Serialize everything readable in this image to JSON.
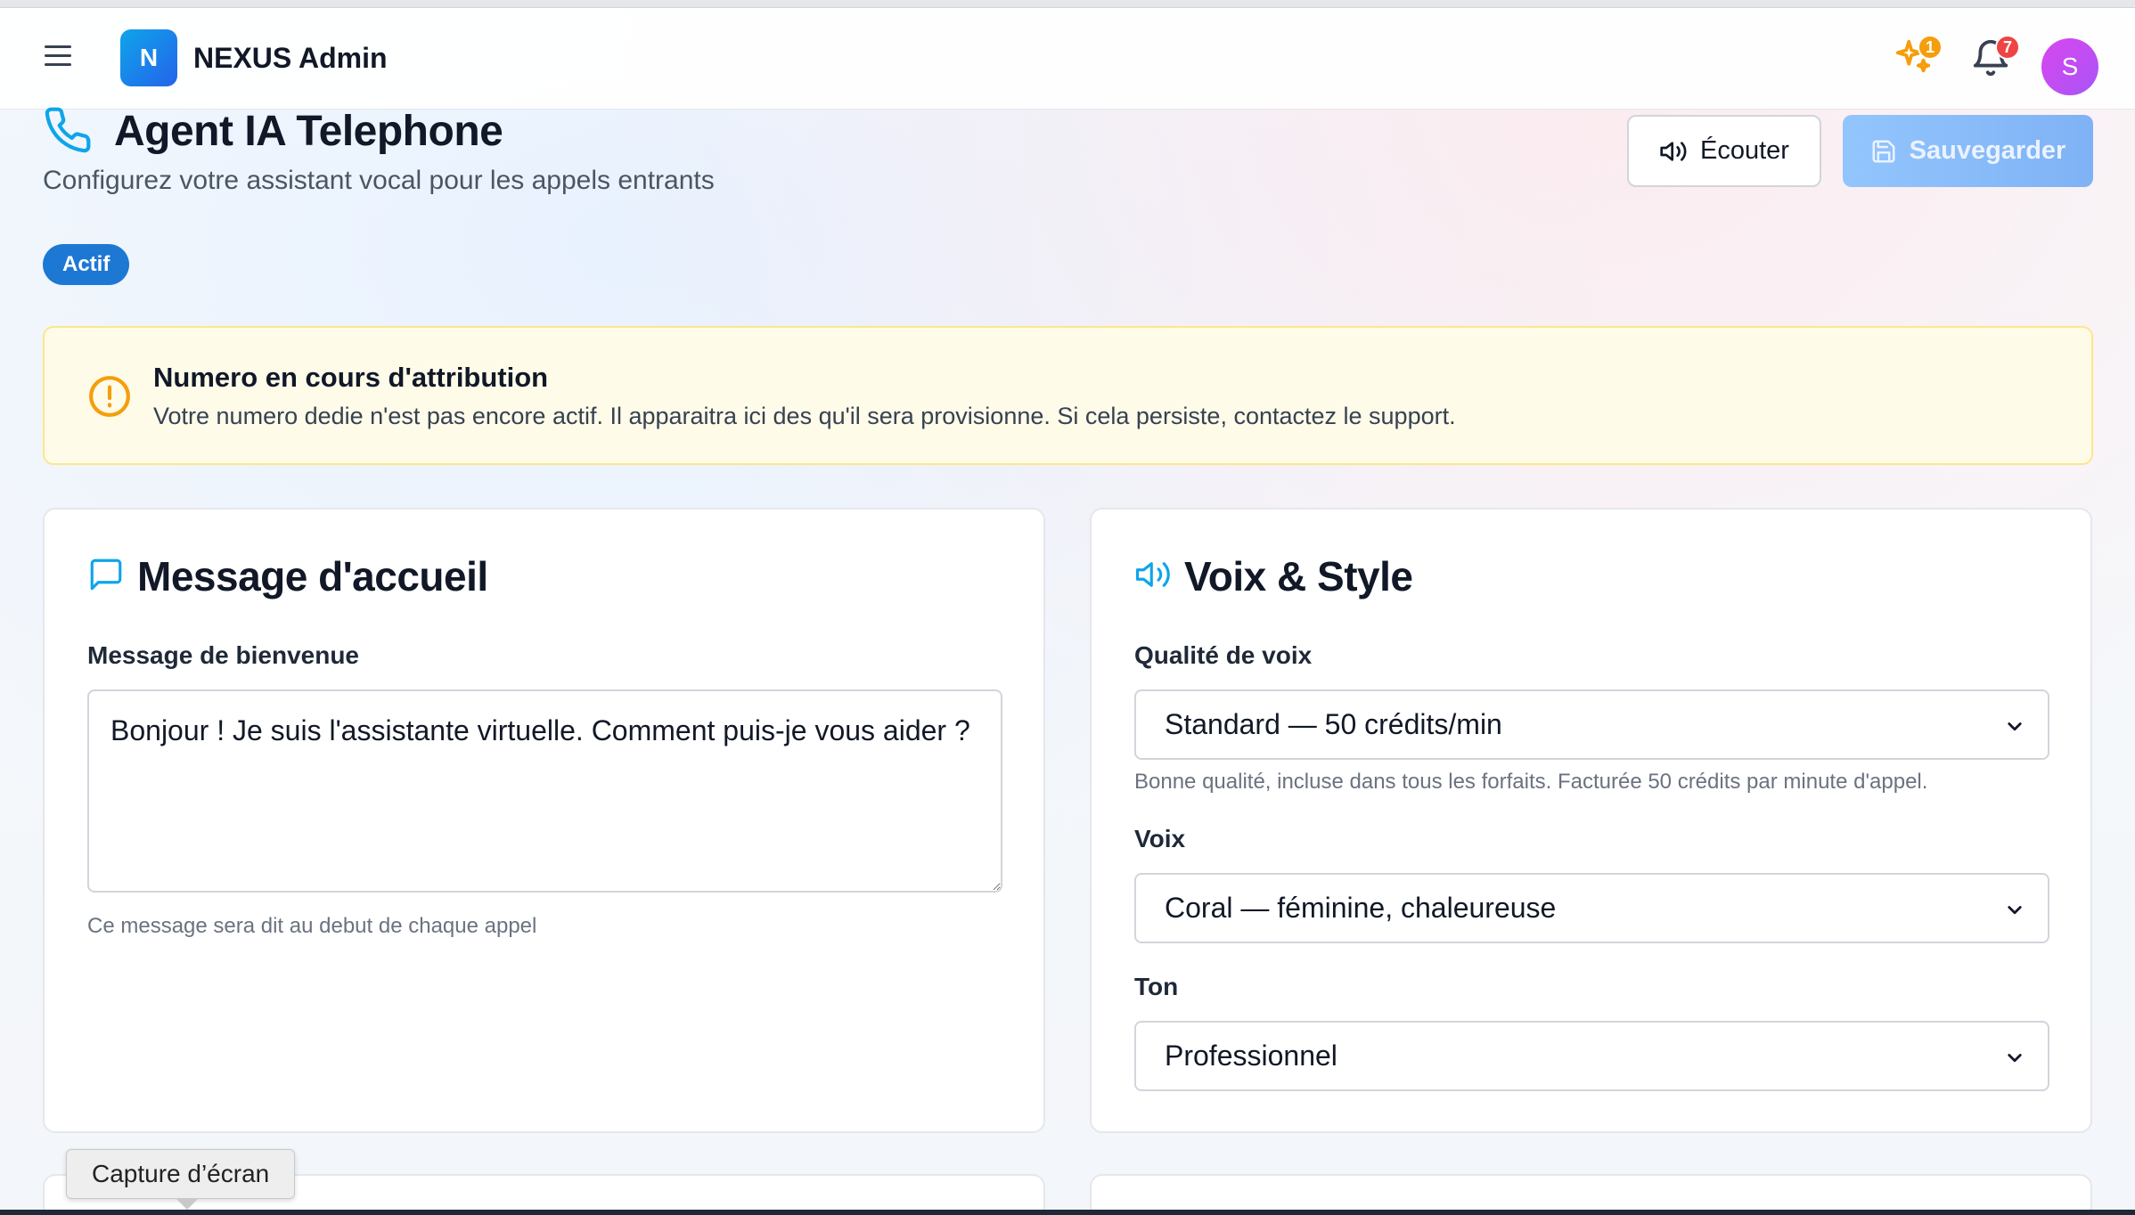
{
  "header": {
    "logo_letter": "N",
    "app_name": "NEXUS Admin",
    "sparkle_badge": "1",
    "notification_badge": "7",
    "avatar_letter": "S"
  },
  "page": {
    "title": "Agent IA Telephone",
    "subtitle": "Configurez votre assistant vocal pour les appels entrants",
    "listen_label": "Écouter",
    "save_label": "Sauvegarder",
    "status": "Actif"
  },
  "alert": {
    "title": "Numero en cours d'attribution",
    "text": "Votre numero dedie n'est pas encore actif. Il apparaitra ici des qu'il sera provisionne. Si cela persiste, contactez le support."
  },
  "greeting_card": {
    "title": "Message d'accueil",
    "field_label": "Message de bienvenue",
    "message_value": "Bonjour ! Je suis l'assistante virtuelle. Comment puis-je vous aider ?",
    "hint": "Ce message sera dit au debut de chaque appel"
  },
  "voice_card": {
    "title": "Voix & Style",
    "quality_label": "Qualité de voix",
    "quality_value": "Standard — 50 crédits/min",
    "quality_hint": "Bonne qualité, incluse dans tous les forfaits. Facturée 50 crédits par minute d'appel.",
    "voice_label": "Voix",
    "voice_value": "Coral — féminine, chaleureuse",
    "tone_label": "Ton",
    "tone_value": "Professionnel"
  },
  "tooltip": "Capture d’écran",
  "colors": {
    "primary": "#1d78d3",
    "accent_icon": "#0ea5e9",
    "warning": "#f59e0b",
    "notification_badge": "#ef4444",
    "avatar": "#c84ee0"
  }
}
